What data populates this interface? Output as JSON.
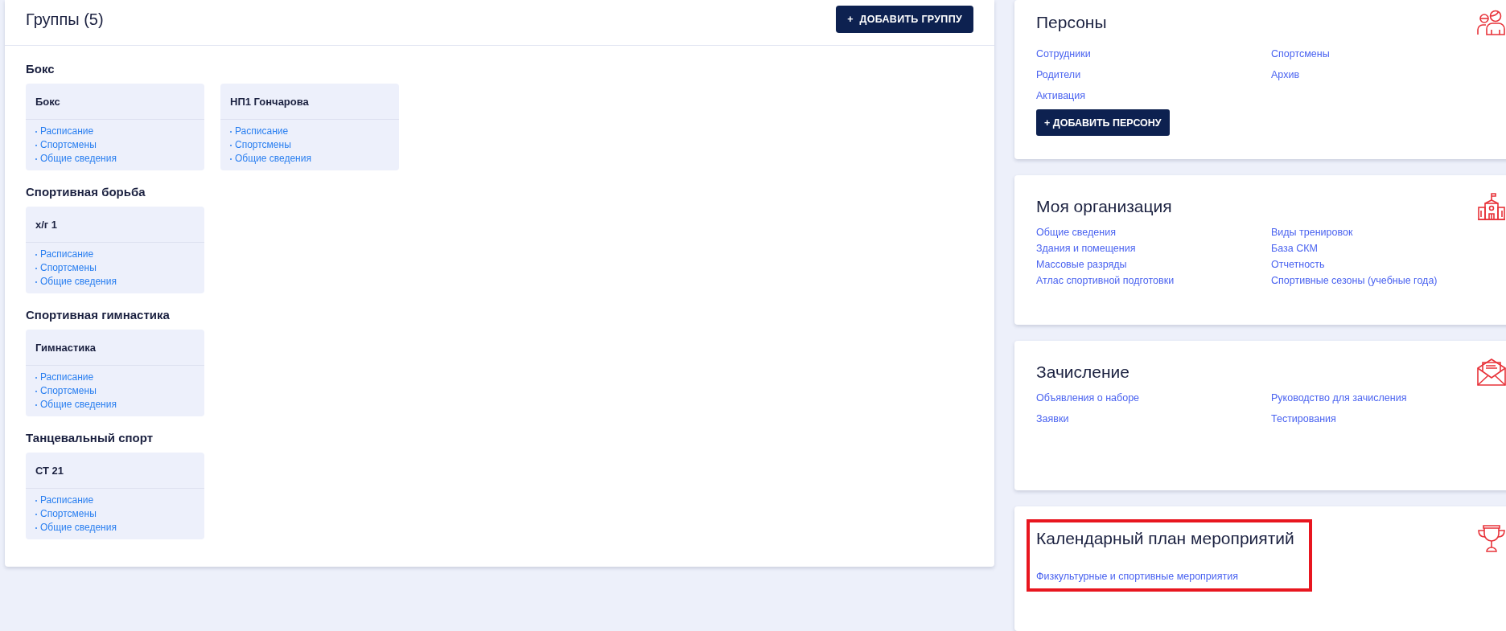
{
  "groups_panel": {
    "title": "Группы (5)",
    "add_button": "+  ДОБАВИТЬ ГРУППУ",
    "categories": [
      {
        "name": "Бокс",
        "groups": [
          {
            "name": "Бокс",
            "links": [
              "Расписание",
              "Спортсмены",
              "Общие сведения"
            ]
          },
          {
            "name": "НП1 Гончарова",
            "links": [
              "Расписание",
              "Спортсмены",
              "Общие сведения"
            ]
          }
        ]
      },
      {
        "name": "Спортивная борьба",
        "groups": [
          {
            "name": "х/г 1",
            "links": [
              "Расписание",
              "Спортсмены",
              "Общие сведения"
            ]
          }
        ]
      },
      {
        "name": "Спортивная гимнастика",
        "groups": [
          {
            "name": "Гимнастика",
            "links": [
              "Расписание",
              "Спортсмены",
              "Общие сведения"
            ]
          }
        ]
      },
      {
        "name": "Танцевальный спорт",
        "groups": [
          {
            "name": "СТ 21",
            "links": [
              "Расписание",
              "Спортсмены",
              "Общие сведения"
            ]
          }
        ]
      }
    ]
  },
  "sections": [
    {
      "title": "Персоны",
      "highlighted": false,
      "links": [
        [
          "Сотрудники",
          "Родители",
          "Активация"
        ],
        [
          "Спортсмены",
          "Архив"
        ]
      ],
      "button": "+ ДОБАВИТЬ ПЕРСОНУ"
    },
    {
      "title": "Моя организация",
      "highlighted": false,
      "links": [
        [
          "Общие сведения",
          "Здания и помещения",
          "Массовые разряды",
          "Атлас спортивной подготовки"
        ],
        [
          "Виды тренировок",
          "База СКМ",
          "Отчетность",
          "Спортивные сезоны (учебные года)"
        ]
      ]
    },
    {
      "title": "Зачисление",
      "highlighted": false,
      "links": [
        [
          "Объявления о наборе",
          "Заявки"
        ],
        [
          "Руководство для зачисления",
          "Тестирования"
        ]
      ]
    },
    {
      "title": "Календарный план мероприятий",
      "highlighted": true,
      "links": [
        [
          "Физкультурные и спортивные мероприятия"
        ]
      ]
    }
  ]
}
